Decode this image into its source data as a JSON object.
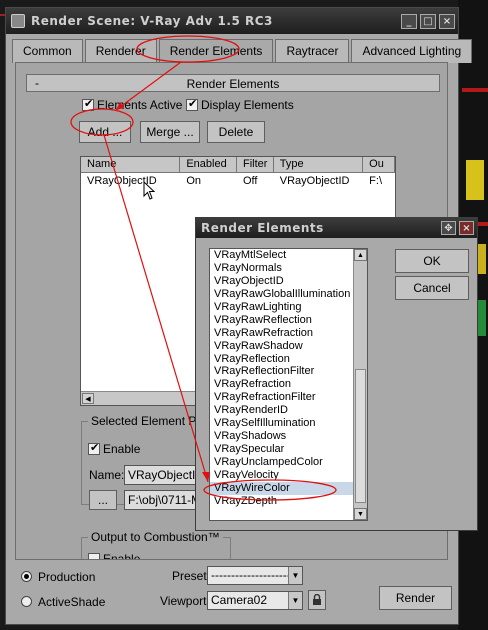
{
  "window": {
    "title": "Render Scene: V-Ray Adv 1.5 RC3",
    "buttons": {
      "minimize": "_",
      "maximize": "□",
      "close": "×"
    }
  },
  "tabs": [
    "Common",
    "Renderer",
    "Render Elements",
    "Raytracer",
    "Advanced Lighting"
  ],
  "active_tab": "Render Elements",
  "rollout": {
    "toggle": "-",
    "title": "Render Elements"
  },
  "options": {
    "elements_active": "Elements Active",
    "display_elements": "Display Elements"
  },
  "buttons": {
    "add": "Add ...",
    "merge": "Merge ...",
    "delete": "Delete"
  },
  "elements_table": {
    "headers": [
      "Name",
      "Enabled",
      "Filter",
      "Type",
      "Ou"
    ],
    "rows": [
      {
        "name": "VRayObjectID",
        "enabled": "On",
        "filter": "Off",
        "type": "VRayObjectID",
        "output": "F:\\"
      }
    ]
  },
  "selected_params": {
    "title": "Selected Element Para",
    "enable": "Enable",
    "name_label": "Name:",
    "name_value": "VRayObjectID",
    "browse": "...",
    "path_value": "F:\\obj\\0711-M"
  },
  "combustion": {
    "title": "Output to Combustion™",
    "enable": "Enable"
  },
  "bottom": {
    "production": "Production",
    "activeshade": "ActiveShade",
    "preset_label": "Preset:",
    "preset_value": "--------------------",
    "viewport_label": "Viewport:",
    "viewport_value": "Camera02",
    "render": "Render"
  },
  "dialog": {
    "title": "Render Elements",
    "items": [
      "VRayMtlSelect",
      "VRayNormals",
      "VRayObjectID",
      "VRayRawGlobalIllumination",
      "VRayRawLighting",
      "VRayRawReflection",
      "VRayRawRefraction",
      "VRayRawShadow",
      "VRayReflection",
      "VRayReflectionFilter",
      "VRayRefraction",
      "VRayRefractionFilter",
      "VRayRenderID",
      "VRaySelfIllumination",
      "VRayShadows",
      "VRaySpecular",
      "VRayUnclampedColor",
      "VRayVelocity",
      "VRayWireColor",
      "VRayZDepth"
    ],
    "selected_item": "VRayWireColor",
    "ok": "OK",
    "cancel": "Cancel"
  },
  "colors": {
    "annotation": "#e01010",
    "titlebar": "#2b2b2b",
    "panel": "#a9a9a9"
  }
}
